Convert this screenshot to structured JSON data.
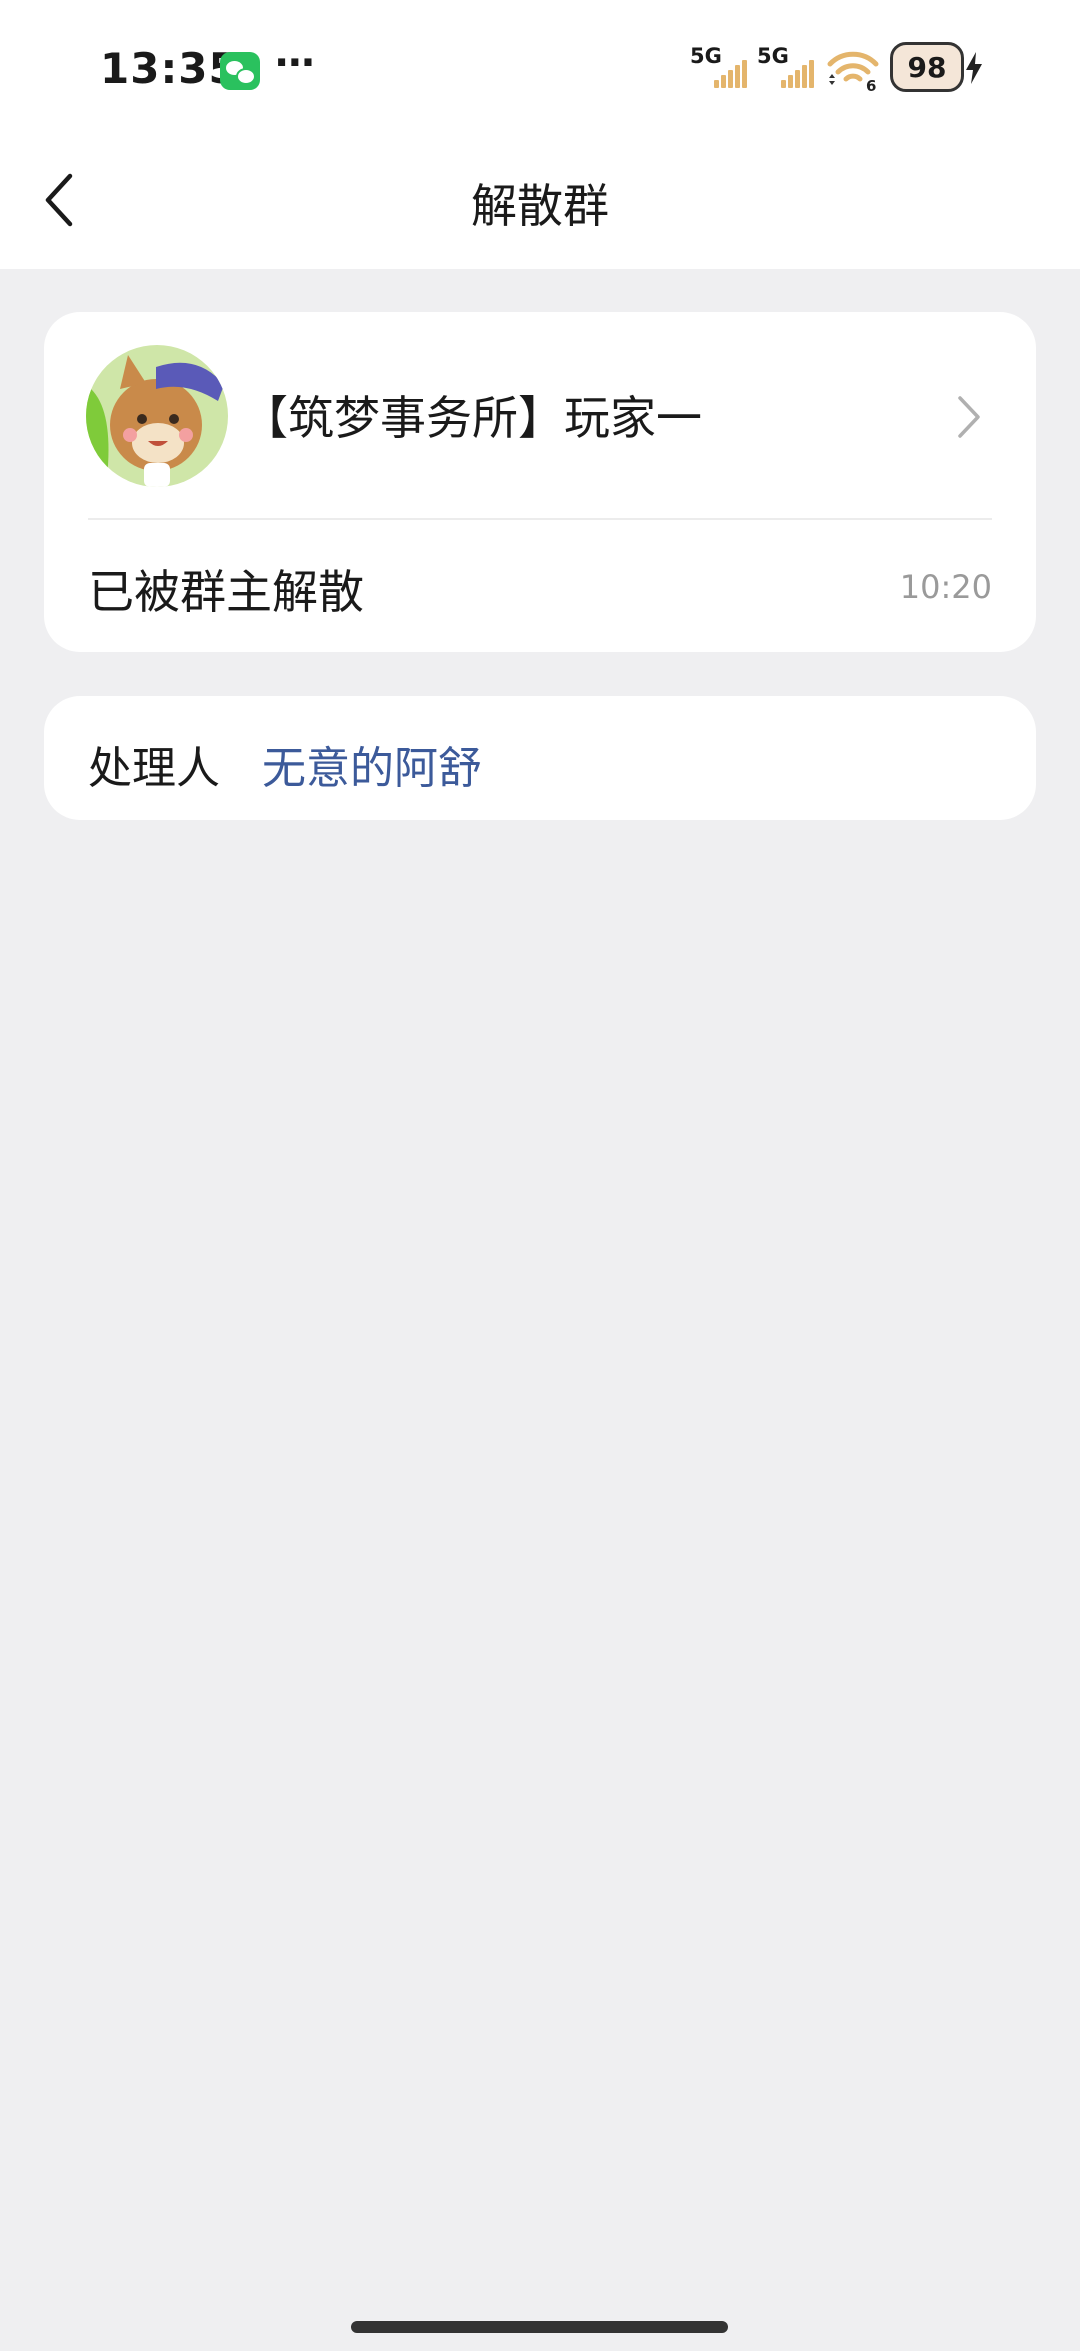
{
  "status_bar": {
    "time": "13:35",
    "more_indicator": "···",
    "signal_labels": [
      "5G",
      "5G"
    ],
    "wifi_badge": "6",
    "battery_level": "98",
    "icons": [
      "wechat-icon",
      "signal-icon",
      "wifi-icon",
      "battery-icon",
      "charging-icon"
    ],
    "colors": {
      "wechat": "#2ac15e",
      "signal_bars": "#e4b56c"
    }
  },
  "navbar": {
    "title": "解散群",
    "back_icon": "chevron-left-icon"
  },
  "group_card": {
    "group_name": "【筑梦事务所】玩家一",
    "message": "已被群主解散",
    "message_time": "10:20",
    "chevron_icon": "chevron-right-icon"
  },
  "handler_card": {
    "label": "处理人",
    "name": "无意的阿舒",
    "name_color": "#3c5a9a"
  },
  "colors": {
    "background": "#efeff1",
    "card": "#ffffff"
  }
}
